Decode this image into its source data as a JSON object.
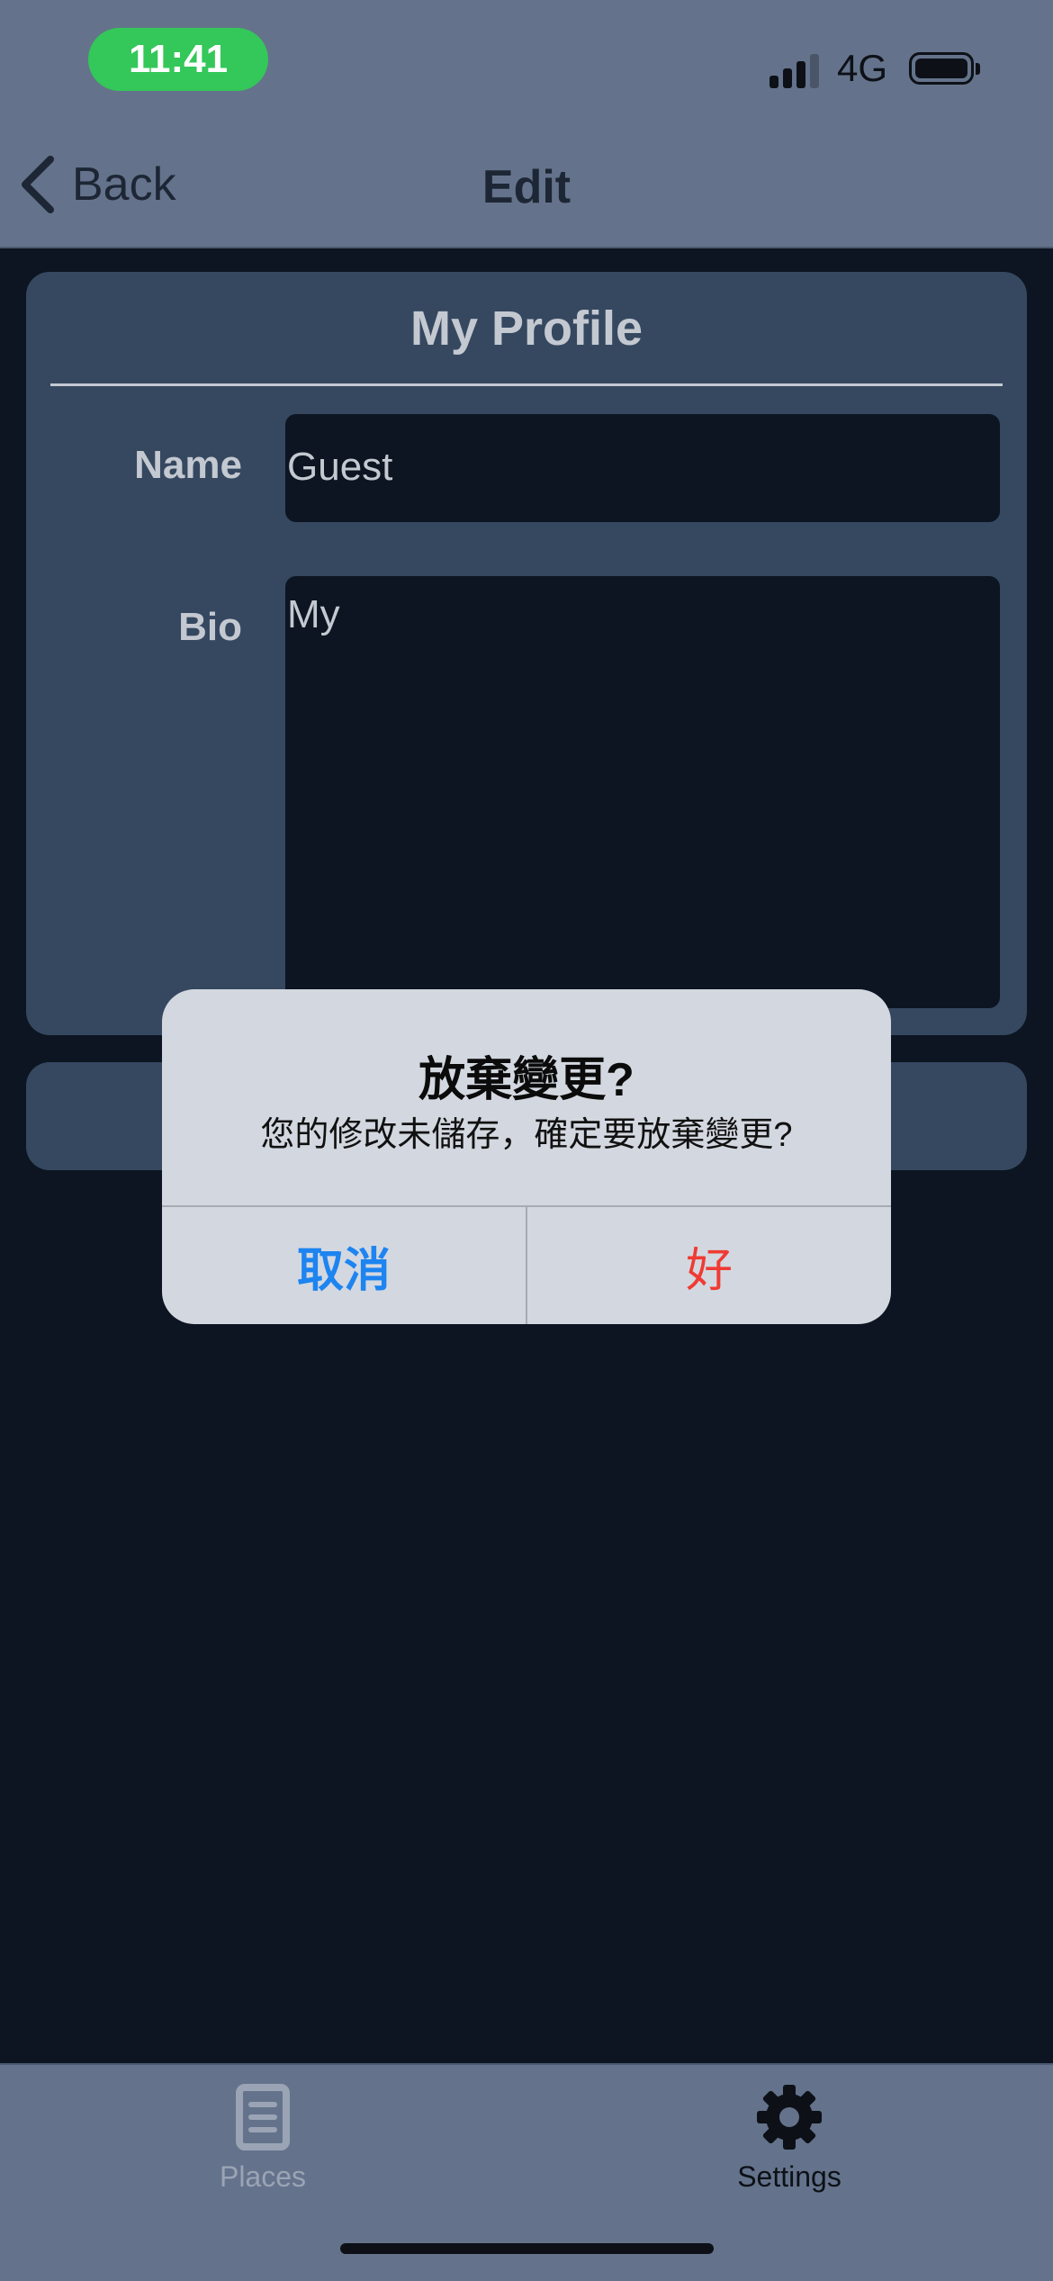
{
  "status_bar": {
    "time": "11:41",
    "network": "4G"
  },
  "nav": {
    "back_label": "Back",
    "title": "Edit"
  },
  "profile": {
    "title": "My Profile",
    "name_label": "Name",
    "name_value": "Guest",
    "bio_label": "Bio",
    "bio_value": "My"
  },
  "alert": {
    "title": "放棄變更?",
    "message": "您的修改未儲存，確定要放棄變更?",
    "cancel_label": "取消",
    "ok_label": "好"
  },
  "tabbar": {
    "items": [
      {
        "label": "Places",
        "icon": "document-icon",
        "active": false
      },
      {
        "label": "Settings",
        "icon": "gear-icon",
        "active": true
      }
    ]
  },
  "colors": {
    "topbar": "#64738b",
    "background": "#0c1521",
    "card": "#354860",
    "time_pill": "#34c759",
    "alert_cancel": "#1d84f0",
    "alert_ok": "#ef3b33"
  }
}
